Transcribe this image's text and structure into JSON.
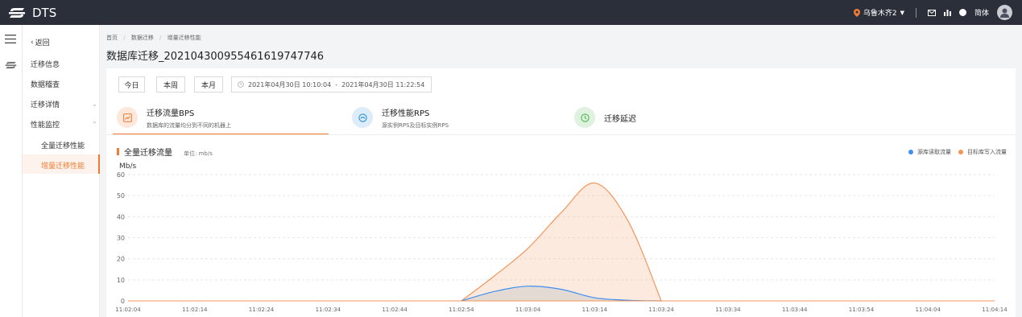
{
  "topbar": {
    "app_name": "DTS",
    "region": "乌鲁木齐2",
    "language": "简体"
  },
  "sidemenu": {
    "back": "返回",
    "items": [
      {
        "label": "迁移信息"
      },
      {
        "label": "数据稽查"
      },
      {
        "label": "迁移详情"
      },
      {
        "label": "性能监控"
      },
      {
        "label": "全量迁移性能"
      },
      {
        "label": "增量迁移性能"
      }
    ]
  },
  "breadcrumb": {
    "home": "首页",
    "level2": "数据迁移",
    "level3": "增量迁移性能",
    "sep": "/"
  },
  "page_title": "数据库迁移_20210430095546161974774​6",
  "filters": {
    "today": "今日",
    "week": "本周",
    "month": "本月",
    "range_start": "2021年04月30日 10:10:04",
    "range_sep": "-",
    "range_end": "2021年04月30日 11:22:54"
  },
  "tabs": [
    {
      "title": "迁移流量BPS",
      "subtitle": "数据库的流量均分到不同的机器上"
    },
    {
      "title": "迁移性能RPS",
      "subtitle": "源实例RPS及目标实例RPS"
    },
    {
      "title": "迁移延迟",
      "subtitle": ""
    }
  ],
  "chart_header": {
    "title": "全量迁移流量",
    "unit": "单位: mb/s"
  },
  "colors": {
    "accent": "#f07b35",
    "source": "#3e8ff2",
    "target": "#f3955a",
    "rps_icon": "#2b8fd6",
    "delay_icon": "#4cb84c"
  },
  "chart_data": {
    "type": "area",
    "title": "",
    "xlabel": "",
    "ylabel": "Mb/s",
    "ylim": [
      0,
      60
    ],
    "yticks": [
      "0",
      "10",
      "20",
      "30",
      "40",
      "50",
      "60"
    ],
    "x": [
      "11:02:04",
      "11:02:14",
      "11:02:24",
      "11:02:34",
      "11:02:44",
      "11:02:54",
      "11:03:04",
      "11:03:14",
      "11:03:24",
      "11:03:34",
      "11:03:44",
      "11:03:54",
      "11:04:04",
      "11:04:14"
    ],
    "grid": true,
    "legend_position": "top-right",
    "series": [
      {
        "name": "源库读取流量",
        "color": "#3e8ff2",
        "x": [
          "11:02:54",
          "11:02:59",
          "11:03:04",
          "11:03:09",
          "11:03:14",
          "11:03:19",
          "11:03:24"
        ],
        "values": [
          0,
          4.5,
          7,
          5.5,
          1.5,
          0.3,
          0
        ]
      },
      {
        "name": "目标库写入流量",
        "color": "#f3955a",
        "x": [
          "11:02:54",
          "11:02:59",
          "11:03:04",
          "11:03:09",
          "11:03:14",
          "11:03:19",
          "11:03:24"
        ],
        "values": [
          0,
          12,
          25,
          42,
          56,
          38,
          0
        ]
      }
    ]
  }
}
